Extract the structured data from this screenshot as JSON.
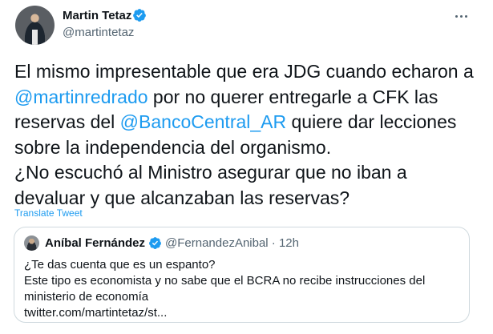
{
  "tweet": {
    "author_name": "Martin Tetaz",
    "author_handle": "@martintetaz",
    "text_lines": [
      [
        {
          "t": "El mismo impresentable que era JDG cuando echaron a",
          "m": false
        }
      ],
      [
        {
          "t": "@martinredrado",
          "m": true
        },
        {
          "t": " por no querer entregarle a CFK las",
          "m": false
        }
      ],
      [
        {
          "t": "reservas del ",
          "m": false
        },
        {
          "t": "@BancoCentral_AR",
          "m": true
        },
        {
          "t": " quiere dar lecciones",
          "m": false
        }
      ],
      [
        {
          "t": "sobre la independencia del organismo.",
          "m": false
        }
      ],
      [
        {
          "t": "¿No escuchó al Ministro  asegurar que no iban a",
          "m": false
        }
      ],
      [
        {
          "t": "devaluar y que alcanzaban las reservas?",
          "m": false
        }
      ]
    ],
    "translate_label": "Translate Tweet",
    "accent_color": "#1d9bf0"
  },
  "quote": {
    "author_name": "Aníbal Fernández",
    "handle_time": "@FernandezAnibal · 12h",
    "text_lines": [
      "¿Te das cuenta que es un espanto?",
      "Este tipo es economista y no sabe que el BCRA no recibe instrucciones del",
      "ministerio de economía",
      "twitter.com/martintetaz/st..."
    ]
  },
  "icons": {
    "verified": "verified-badge-icon",
    "more": "more-options-icon"
  }
}
